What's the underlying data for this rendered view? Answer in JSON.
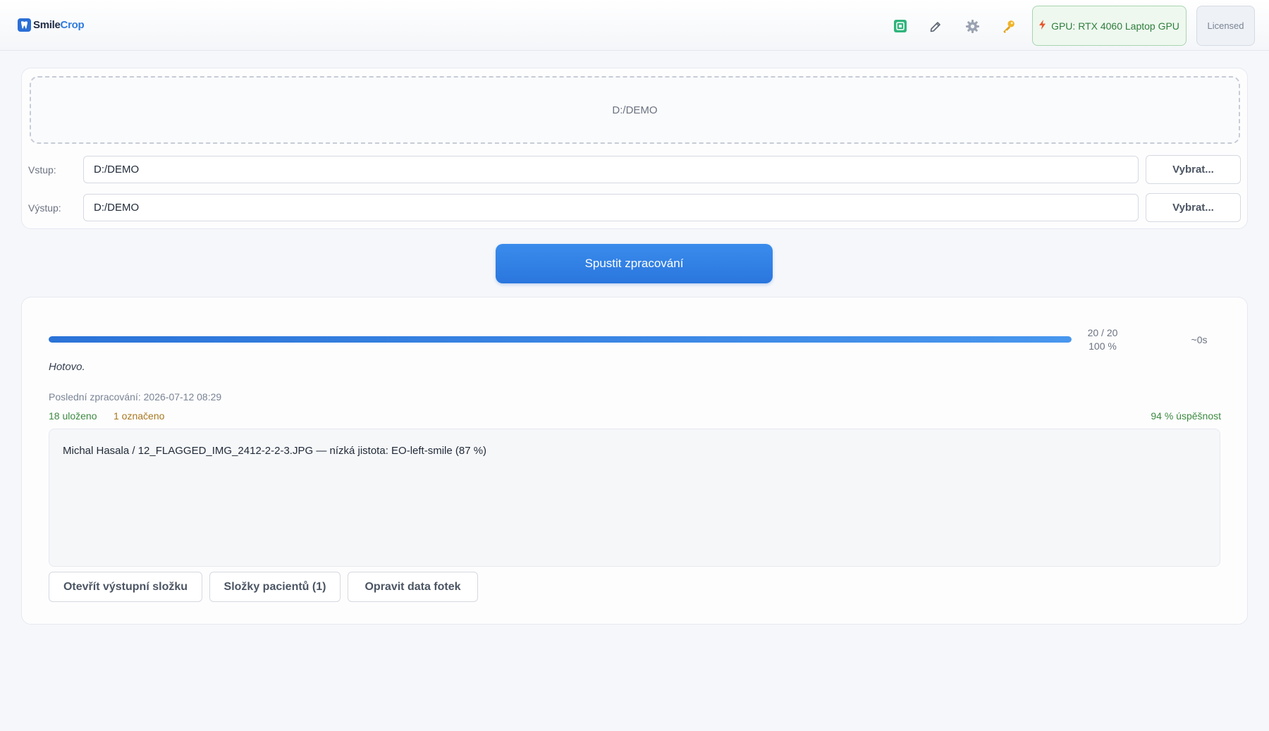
{
  "header": {
    "logo_text_main": "Smile",
    "logo_text_accent": "Crop",
    "icons": [
      "chip-icon",
      "pencil-icon",
      "gear-icon",
      "key-icon"
    ],
    "gpu_label": "GPU: RTX 4060 Laptop GPU",
    "license_label": "Licensed",
    "colors": {
      "gpu_text": "#2f7d3c",
      "accent": "#2f7be0"
    }
  },
  "input": {
    "dropzone_text": "D:/DEMO",
    "input_label": "Vstup:",
    "input_value": "D:/DEMO",
    "output_label": "Výstup:",
    "output_value": "D:/DEMO",
    "choose_label": "Vybrat..."
  },
  "run_button": "Spustit zpracování",
  "results": {
    "progress_fraction": 1.0,
    "progress_count": "20 / 20",
    "progress_percent": "100 %",
    "eta": "~0s",
    "status": "Hotovo.",
    "last_run": "Poslední zpracování: 2026-07-12  08:29",
    "saved": "18 uloženo",
    "flagged": "1 označeno",
    "success": "94 % úspěšnost",
    "log": [
      "Michal Hasala  /  12_FLAGGED_IMG_2412-2-2-3.JPG  —  nízká jistota: EO-left-smile (87 %)"
    ],
    "buttons": {
      "open_output": "Otevřít výstupní složku",
      "patient_folders": "Složky pacientů (1)",
      "fix_photo_data": "Opravit data fotek"
    }
  }
}
